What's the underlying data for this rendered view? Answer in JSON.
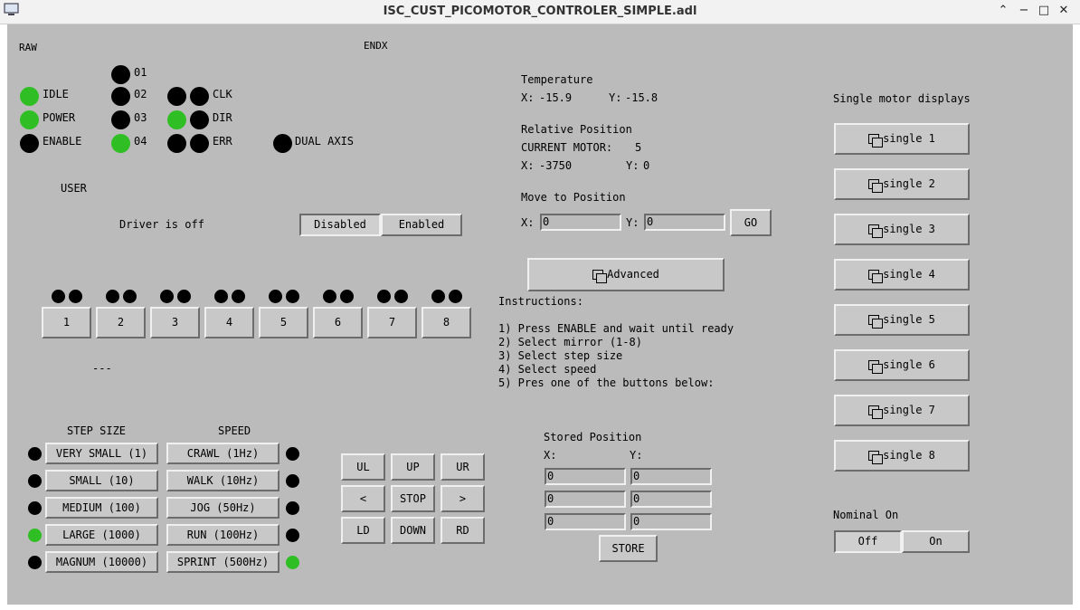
{
  "window": {
    "title": "ISC_CUST_PICOMOTOR_CONTROLER_SIMPLE.adl"
  },
  "header": {
    "raw": "RAW",
    "endx": "ENDX"
  },
  "status_leds": [
    {
      "label": "IDLE",
      "state": "on"
    },
    {
      "label": "POWER",
      "state": "on"
    },
    {
      "label": "ENABLE",
      "state": "off"
    }
  ],
  "channel_leds": [
    {
      "label": "01",
      "state": "off"
    },
    {
      "label": "02",
      "state": "off"
    },
    {
      "label": "03",
      "state": "off"
    },
    {
      "label": "04",
      "state": "on"
    }
  ],
  "signal_leds": [
    {
      "label": "CLK",
      "states": [
        "off",
        "off"
      ]
    },
    {
      "label": "DIR",
      "states": [
        "on",
        "off"
      ]
    },
    {
      "label": "ERR",
      "states": [
        "off",
        "off"
      ]
    }
  ],
  "dual_axis": {
    "label": "DUAL AXIS",
    "state": "off"
  },
  "user": {
    "heading": "USER",
    "driver_status": "Driver is off",
    "disabled_label": "Disabled",
    "enabled_label": "Enabled"
  },
  "motors": [
    {
      "label": "1",
      "leds": [
        "off",
        "off"
      ]
    },
    {
      "label": "2",
      "leds": [
        "off",
        "off"
      ]
    },
    {
      "label": "3",
      "leds": [
        "off",
        "off"
      ]
    },
    {
      "label": "4",
      "leds": [
        "off",
        "off"
      ]
    },
    {
      "label": "5",
      "leds": [
        "off",
        "off"
      ]
    },
    {
      "label": "6",
      "leds": [
        "off",
        "off"
      ]
    },
    {
      "label": "7",
      "leds": [
        "off",
        "off"
      ]
    },
    {
      "label": "8",
      "leds": [
        "off",
        "off"
      ]
    }
  ],
  "selected_motor_text": "---",
  "step_size": {
    "heading": "STEP SIZE",
    "options": [
      {
        "label": "VERY SMALL (1)",
        "state": "off"
      },
      {
        "label": "SMALL (10)",
        "state": "off"
      },
      {
        "label": "MEDIUM (100)",
        "state": "off"
      },
      {
        "label": "LARGE (1000)",
        "state": "on"
      },
      {
        "label": "MAGNUM (10000)",
        "state": "off"
      }
    ]
  },
  "speed": {
    "heading": "SPEED",
    "options": [
      {
        "label": "CRAWL (1Hz)",
        "state": "off"
      },
      {
        "label": "WALK (10Hz)",
        "state": "off"
      },
      {
        "label": "JOG (50Hz)",
        "state": "off"
      },
      {
        "label": "RUN (100Hz)",
        "state": "off"
      },
      {
        "label": "SPRINT (500Hz)",
        "state": "on"
      }
    ]
  },
  "jog_pad": {
    "ul": "UL",
    "up": "UP",
    "ur": "UR",
    "left": "<",
    "stop": "STOP",
    "right": ">",
    "ld": "LD",
    "down": "DOWN",
    "rd": "RD"
  },
  "temperature": {
    "heading": "Temperature",
    "x_label": "X:",
    "x_value": "-15.9",
    "y_label": "Y:",
    "y_value": "-15.8"
  },
  "relative_position": {
    "heading": "Relative Position",
    "current_motor_label": "CURRENT MOTOR:",
    "current_motor_value": "5",
    "x_label": "X:",
    "x_value": "-3750",
    "y_label": "Y:",
    "y_value": "0"
  },
  "move_to_position": {
    "heading": "Move to Position",
    "x_label": "X:",
    "x_value": "0",
    "y_label": "Y:",
    "y_value": "0",
    "go_label": "GO"
  },
  "advanced_label": "Advanced",
  "instructions": {
    "heading": "Instructions:",
    "lines": [
      "1) Press ENABLE and wait until ready",
      "2) Select mirror (1-8)",
      "3) Select step size",
      "4) Select speed",
      "5) Pres one of the buttons below:"
    ]
  },
  "stored_position": {
    "heading": "Stored Position",
    "x_label": "X:",
    "y_label": "Y:",
    "rows": [
      {
        "x": "0",
        "y": "0"
      },
      {
        "x": "0",
        "y": "0"
      },
      {
        "x": "0",
        "y": "0"
      }
    ],
    "store_label": "STORE"
  },
  "single_displays": {
    "heading": "Single motor displays",
    "buttons": [
      "single 1",
      "single 2",
      "single 3",
      "single 4",
      "single 5",
      "single 6",
      "single 7",
      "single 8"
    ]
  },
  "nominal": {
    "heading": "Nominal On",
    "off_label": "Off",
    "on_label": "On"
  },
  "colors": {
    "background": "#bbbbbb",
    "led_on": "#2fbf25",
    "led_off": "#000000",
    "button": "#c8c8c8"
  }
}
